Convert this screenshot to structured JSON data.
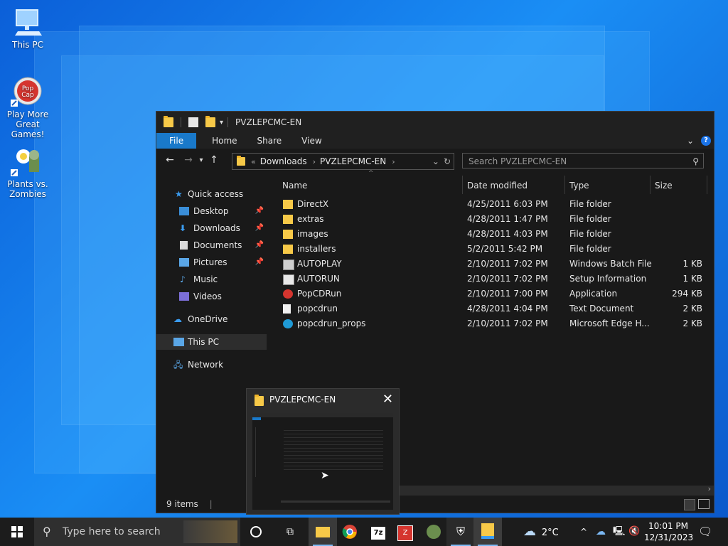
{
  "desktop": {
    "icons": [
      {
        "label": "This PC"
      },
      {
        "label": "Play More Great Games!"
      },
      {
        "label": "Plants vs. Zombies"
      }
    ]
  },
  "window": {
    "title": "PVZLEPCMC-EN",
    "ribbon_tabs": [
      "File",
      "Home",
      "Share",
      "View"
    ],
    "breadcrumb": [
      "Downloads",
      "PVZLEPCMC-EN"
    ],
    "search_placeholder": "Search PVZLEPCMC-EN",
    "nav": {
      "quick_access": "Quick access",
      "items": [
        "Desktop",
        "Downloads",
        "Documents",
        "Pictures",
        "Music",
        "Videos"
      ],
      "onedrive": "OneDrive",
      "this_pc": "This PC",
      "network": "Network"
    },
    "columns": {
      "name": "Name",
      "date": "Date modified",
      "type": "Type",
      "size": "Size"
    },
    "files": [
      {
        "name": "DirectX",
        "date": "4/25/2011 6:03 PM",
        "type": "File folder",
        "size": "",
        "icon": "folder-icon"
      },
      {
        "name": "extras",
        "date": "4/28/2011 1:47 PM",
        "type": "File folder",
        "size": "",
        "icon": "folder-icon"
      },
      {
        "name": "images",
        "date": "4/28/2011 4:03 PM",
        "type": "File folder",
        "size": "",
        "icon": "folder-icon"
      },
      {
        "name": "installers",
        "date": "5/2/2011 5:42 PM",
        "type": "File folder",
        "size": "",
        "icon": "folder-icon"
      },
      {
        "name": "AUTOPLAY",
        "date": "2/10/2011 7:02 PM",
        "type": "Windows Batch File",
        "size": "1 KB",
        "icon": "batch-file-icon"
      },
      {
        "name": "AUTORUN",
        "date": "2/10/2011 7:02 PM",
        "type": "Setup Information",
        "size": "1 KB",
        "icon": "setup-file-icon"
      },
      {
        "name": "PopCDRun",
        "date": "2/10/2011 7:00 PM",
        "type": "Application",
        "size": "294 KB",
        "icon": "app-icon"
      },
      {
        "name": "popcdrun",
        "date": "4/28/2011 4:04 PM",
        "type": "Text Document",
        "size": "2 KB",
        "icon": "text-file-icon"
      },
      {
        "name": "popcdrun_props",
        "date": "2/10/2011 7:02 PM",
        "type": "Microsoft Edge H...",
        "size": "2 KB",
        "icon": "edge-icon"
      }
    ],
    "status": "9 items"
  },
  "thumbnail": {
    "title": "PVZLEPCMC-EN"
  },
  "taskbar": {
    "search_placeholder": "Type here to search",
    "weather": "2°C",
    "time": "10:01 PM",
    "date": "12/31/2023"
  },
  "colors": {
    "accent": "#1979ca",
    "window_bg": "#191919",
    "folder": "#f7c948"
  }
}
